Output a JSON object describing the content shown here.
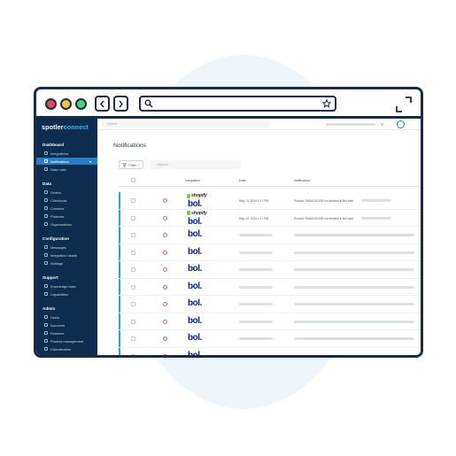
{
  "brand": {
    "part1": "spotler",
    "part2": "connect"
  },
  "sidebar": {
    "sections": [
      {
        "title": "Dashboard",
        "items": [
          {
            "label": "Integrations",
            "icon": "integrations-icon"
          },
          {
            "label": "Notifications",
            "icon": "bell-icon",
            "active": true
          },
          {
            "label": "Data rules",
            "icon": "rules-icon"
          }
        ]
      },
      {
        "title": "Data",
        "items": [
          {
            "label": "Orders",
            "icon": "cart-icon"
          },
          {
            "label": "Checkouts",
            "icon": "checkout-icon"
          },
          {
            "label": "Contacts",
            "icon": "contacts-icon"
          },
          {
            "label": "Products",
            "icon": "box-icon"
          },
          {
            "label": "Organisations",
            "icon": "building-icon"
          }
        ]
      },
      {
        "title": "Configuration",
        "items": [
          {
            "label": "Messages",
            "icon": "message-icon"
          },
          {
            "label": "Integration health",
            "icon": "health-icon"
          },
          {
            "label": "Settings",
            "icon": "gear-icon"
          }
        ]
      },
      {
        "title": "Support",
        "items": [
          {
            "label": "Knowledge base",
            "icon": "book-icon"
          },
          {
            "label": "Capabilities",
            "icon": "capabilities-icon"
          }
        ]
      },
      {
        "title": "Admin",
        "items": [
          {
            "label": "Users",
            "icon": "users-icon"
          },
          {
            "label": "Accounts",
            "icon": "accounts-icon"
          },
          {
            "label": "Features",
            "icon": "features-icon"
          },
          {
            "label": "Product management",
            "icon": "product-management-icon"
          },
          {
            "label": "Classification",
            "icon": "classification-icon"
          }
        ]
      }
    ]
  },
  "topbar": {
    "search_placeholder": "Search"
  },
  "page": {
    "title": "Notifications",
    "filter_label": "Filter",
    "search_placeholder": "Search...",
    "columns": {
      "integration": "Integration",
      "date": "Date",
      "notification": "Notification"
    },
    "rows": [
      {
        "shopify": "shopify",
        "bol": "bol.",
        "date": "May 13, 2024 1:17 PM",
        "notification": "Product 7506104/2000 not created in Bol.com"
      },
      {
        "shopify": "shopify",
        "bol": "bol.",
        "date": "May 13, 2024 1:17 PM",
        "notification": "Product 7506104/2000 not created in Bol.com"
      },
      {
        "bol": "bol."
      },
      {
        "bol": "bol."
      },
      {
        "bol": "bol."
      },
      {
        "bol": "bol."
      },
      {
        "bol": "bol."
      },
      {
        "bol": "bol."
      },
      {
        "bol": "bol."
      },
      {
        "bol": "bol."
      }
    ]
  },
  "colors": {
    "frame": "#1a2b44",
    "sidebar": "#0c2d4f",
    "active": "#2a7fc4",
    "brand_accent": "#3fb3e8",
    "bol": "#0b1c8c",
    "row_accent": "#27a6e0"
  }
}
